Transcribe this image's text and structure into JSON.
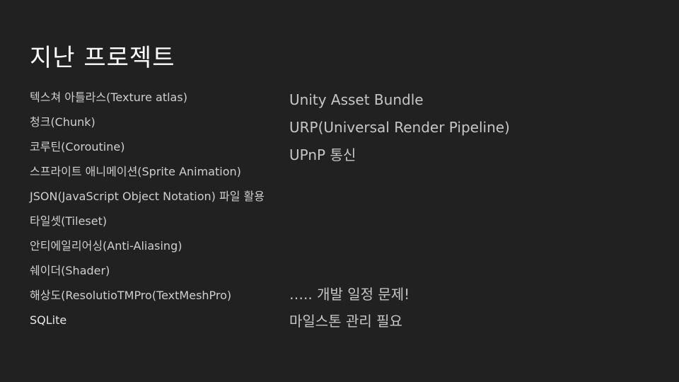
{
  "slide": {
    "title": "지난 프로젝트",
    "left_items": [
      "텍스쳐 아틀라스(Texture atlas)",
      "청크(Chunk)",
      "코루틴(Coroutine)",
      "스프라이트 애니메이션(Sprite Animation)",
      "JSON(JavaScript Object Notation) 파일 활용",
      "타일셋(Tileset)",
      "안티에일리어싱(Anti-Aliasing)",
      "쉐이더(Shader)",
      "해상도(ResolutioTMPro(TextMeshPro)",
      "SQLite"
    ],
    "right_items": [
      "Unity Asset Bundle",
      "URP(Universal Render Pipeline)",
      "UPnP 통신"
    ],
    "notes": [
      "….. 개발 일정 문제!",
      "마일스톤 관리 필요"
    ],
    "colors": {
      "background": "#212121",
      "title": "#ffffff",
      "text": "#cfcfcf"
    }
  }
}
